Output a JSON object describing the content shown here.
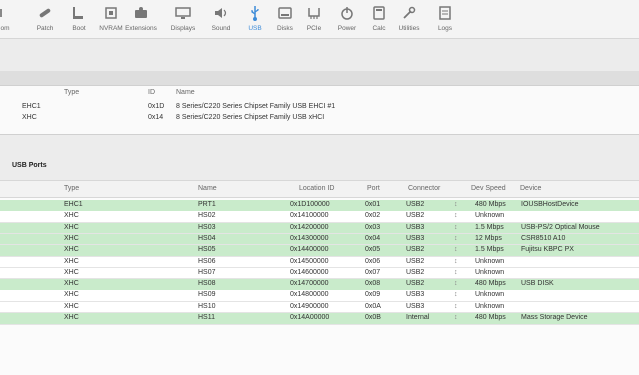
{
  "toolbar": {
    "items": [
      {
        "label": "om",
        "icon": "partial-icon"
      },
      {
        "label": "Patch",
        "icon": "bandage-icon"
      },
      {
        "label": "Boot",
        "icon": "boot-icon"
      },
      {
        "label": "NVRAM",
        "icon": "chip-icon"
      },
      {
        "label": "Extensions",
        "icon": "puzzle-icon"
      },
      {
        "label": "Displays",
        "icon": "display-icon"
      },
      {
        "label": "Sound",
        "icon": "speaker-icon"
      },
      {
        "label": "USB",
        "icon": "usb-icon",
        "active": true
      },
      {
        "label": "Disks",
        "icon": "disk-icon"
      },
      {
        "label": "PCIe",
        "icon": "pcie-icon"
      },
      {
        "label": "Power",
        "icon": "power-icon"
      },
      {
        "label": "Calc",
        "icon": "calculator-icon"
      },
      {
        "label": "Utilities",
        "icon": "wrench-icon"
      },
      {
        "label": "Logs",
        "icon": "log-icon"
      }
    ],
    "accent": "#3d8bd8"
  },
  "controllers": {
    "headers": {
      "type": "Type",
      "id": "ID",
      "name": "Name"
    },
    "rows": [
      {
        "type": "EHC1",
        "id": "0x1D",
        "name": "8 Series/C220 Series Chipset Family USB EHCI #1"
      },
      {
        "type": "XHC",
        "id": "0x14",
        "name": "8 Series/C220 Series Chipset Family USB xHCI"
      }
    ]
  },
  "ports": {
    "title": "USB Ports",
    "headers": {
      "type": "Type",
      "name": "Name",
      "location": "Location ID",
      "port": "Port",
      "connector": "Connector",
      "speed": "Dev Speed",
      "device": "Device"
    },
    "highlight_color": "#c9ebcb",
    "rows": [
      {
        "type": "EHC1",
        "name": "PRT1",
        "location": "0x1D100000",
        "port": "0x01",
        "connector": "USB2",
        "speed": "480 Mbps",
        "device": "IOUSBHostDevice",
        "active": true
      },
      {
        "type": "XHC",
        "name": "HS02",
        "location": "0x14100000",
        "port": "0x02",
        "connector": "USB2",
        "speed": "Unknown",
        "device": "",
        "active": false
      },
      {
        "type": "XHC",
        "name": "HS03",
        "location": "0x14200000",
        "port": "0x03",
        "connector": "USB3",
        "speed": "1.5 Mbps",
        "device": "USB-PS/2 Optical Mouse",
        "active": true
      },
      {
        "type": "XHC",
        "name": "HS04",
        "location": "0x14300000",
        "port": "0x04",
        "connector": "USB3",
        "speed": "12 Mbps",
        "device": "CSR8510 A10",
        "active": true
      },
      {
        "type": "XHC",
        "name": "HS05",
        "location": "0x14400000",
        "port": "0x05",
        "connector": "USB2",
        "speed": "1.5 Mbps",
        "device": "Fujitsu KBPC PX",
        "active": true
      },
      {
        "type": "XHC",
        "name": "HS06",
        "location": "0x14500000",
        "port": "0x06",
        "connector": "USB2",
        "speed": "Unknown",
        "device": "",
        "active": false
      },
      {
        "type": "XHC",
        "name": "HS07",
        "location": "0x14600000",
        "port": "0x07",
        "connector": "USB2",
        "speed": "Unknown",
        "device": "",
        "active": false
      },
      {
        "type": "XHC",
        "name": "HS08",
        "location": "0x14700000",
        "port": "0x08",
        "connector": "USB2",
        "speed": "480 Mbps",
        "device": "USB DISK",
        "active": true
      },
      {
        "type": "XHC",
        "name": "HS09",
        "location": "0x14800000",
        "port": "0x09",
        "connector": "USB3",
        "speed": "Unknown",
        "device": "",
        "active": false
      },
      {
        "type": "XHC",
        "name": "HS10",
        "location": "0x14900000",
        "port": "0x0A",
        "connector": "USB3",
        "speed": "Unknown",
        "device": "",
        "active": false
      },
      {
        "type": "XHC",
        "name": "HS11",
        "location": "0x14A00000",
        "port": "0x0B",
        "connector": "Internal",
        "speed": "480 Mbps",
        "device": "Mass Storage Device",
        "active": true
      }
    ]
  }
}
